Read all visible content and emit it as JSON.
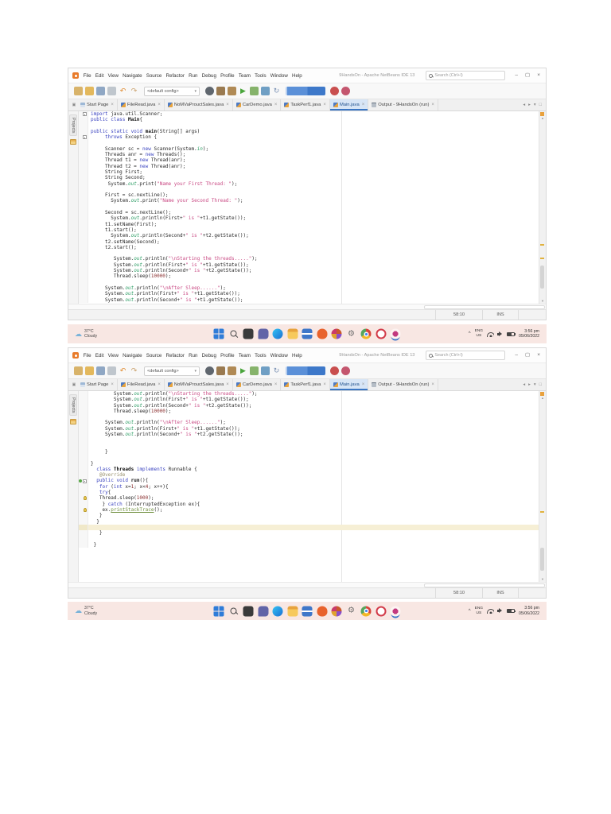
{
  "app": {
    "title": "9HandsOn - Apache NetBeans IDE 13",
    "menus": [
      "File",
      "Edit",
      "View",
      "Navigate",
      "Source",
      "Refactor",
      "Run",
      "Debug",
      "Profile",
      "Team",
      "Tools",
      "Window",
      "Help"
    ],
    "search_placeholder": "Search (Ctrl+I)",
    "window_controls": {
      "minimize": "–",
      "maximize": "▢",
      "close": "×"
    },
    "toolbar": {
      "config_label": "<default config>",
      "icons": [
        {
          "name": "new-file-icon",
          "color": "#d8b36a",
          "shape": "square"
        },
        {
          "name": "open-project-icon",
          "color": "#e3b85c",
          "shape": "square"
        },
        {
          "name": "save-all-icon",
          "color": "#8fa7c4",
          "shape": "square"
        },
        {
          "name": "copy-icon",
          "color": "#bfc6cd",
          "shape": "square"
        },
        {
          "name": "undo-icon",
          "color": "#e08a2e",
          "glyph": "↶"
        },
        {
          "name": "redo-icon",
          "color": "#c9a06a",
          "glyph": "↷"
        },
        {
          "type": "select"
        },
        {
          "name": "ide-globe-icon",
          "color": "#5f666e",
          "shape": "circle"
        },
        {
          "name": "build-project-icon",
          "color": "#9a7a50",
          "shape": "square"
        },
        {
          "name": "clean-build-icon",
          "color": "#b08a55",
          "shape": "square"
        },
        {
          "name": "run-project-icon",
          "color": "#4aa53c",
          "glyph": "▶"
        },
        {
          "name": "debug-project-icon",
          "color": "#86b36b",
          "shape": "square"
        },
        {
          "name": "profile-project-icon",
          "color": "#6f9fc4",
          "shape": "square"
        },
        {
          "name": "reload-icon",
          "color": "#7c93b5",
          "glyph": "↻"
        },
        {
          "type": "mem"
        },
        {
          "name": "profiler-stop-icon",
          "color": "#c94f4f",
          "shape": "circle"
        },
        {
          "name": "profiler-gc-icon",
          "color": "#c4566e",
          "shape": "circle"
        }
      ]
    },
    "tabs": [
      {
        "label": "Start Page",
        "type": "page"
      },
      {
        "label": "FileRead.java",
        "type": "java"
      },
      {
        "label": "NoMVaProuctSales.java",
        "type": "java"
      },
      {
        "label": "CarDemo.java",
        "type": "java"
      },
      {
        "label": "TaskPerf1.java",
        "type": "java"
      },
      {
        "label": "Main.java",
        "type": "java",
        "active": true
      },
      {
        "label": "Output - 9HandsOn (run)",
        "type": "output"
      }
    ],
    "tabnav": [
      {
        "name": "scroll-left-icon",
        "glyph": "◂"
      },
      {
        "name": "scroll-right-icon",
        "glyph": "▸"
      },
      {
        "name": "document-list-icon",
        "glyph": "▾"
      },
      {
        "name": "maximize-window-icon",
        "glyph": "□"
      }
    ],
    "corner_icon": "▣",
    "projects_label": "Projects",
    "status_caret": "58:10",
    "status_mode": "INS",
    "colors": {
      "accent": "#3a76c4",
      "active_tab_bg": "#d7e5f6",
      "string": "#c94a84",
      "keyword": "#3b44c0",
      "highlight_line": "#f6efd5",
      "error_stripe": "#e9a13c"
    }
  },
  "taskbar": {
    "temp": "37°C",
    "condition": "Cloudy",
    "lang_line1": "ENG",
    "lang_line2": "US",
    "time": "3:56 pm",
    "date": "05/06/2022",
    "icons": [
      {
        "name": "start-icon",
        "color": "#2f7cd8"
      },
      {
        "name": "search-icon",
        "color": "#4a4a4a"
      },
      {
        "name": "photos-icon",
        "color": "#3a3a3a"
      },
      {
        "name": "chat-icon",
        "color": "#6264a7"
      },
      {
        "name": "edge-icon",
        "color": "#1b6fd4"
      },
      {
        "name": "file-explorer-icon",
        "color": "#f0b42e"
      },
      {
        "name": "mail-icon",
        "color": "#3f77c9"
      },
      {
        "name": "brave-icon",
        "color": "#e8622c"
      },
      {
        "name": "media-icon",
        "color": "#c9582c"
      },
      {
        "name": "settings-icon",
        "color": "#6e6e6e",
        "glyph": "⚙"
      },
      {
        "name": "chrome-icon",
        "color": "#d7453c"
      },
      {
        "name": "opera-icon",
        "color": "#d23b49"
      },
      {
        "name": "picker-icon",
        "color": "#c2397f"
      }
    ]
  },
  "editors": {
    "one": {
      "lines": [
        {
          "g": "fold",
          "t": [
            [
              "k",
              "import "
            ],
            [
              "p",
              "java.util.Scanner;"
            ]
          ]
        },
        {
          "t": [
            [
              "k",
              "public class "
            ],
            [
              "b",
              "Main"
            ],
            [
              "p",
              "{"
            ]
          ]
        },
        {
          "t": []
        },
        {
          "t": [
            [
              "k",
              "public static void "
            ],
            [
              "b",
              "main"
            ],
            [
              "p",
              "(String[] args)"
            ]
          ]
        },
        {
          "g": "fold",
          "t": [
            [
              "p",
              "     "
            ],
            [
              "k",
              "throws "
            ],
            [
              "p",
              "Exception {"
            ]
          ]
        },
        {
          "t": []
        },
        {
          "t": [
            [
              "p",
              "     Scanner sc = "
            ],
            [
              "k",
              "new "
            ],
            [
              "p",
              "Scanner(System."
            ],
            [
              "f",
              "in"
            ],
            [
              "p",
              ");"
            ]
          ]
        },
        {
          "t": [
            [
              "p",
              "     Threads anr = "
            ],
            [
              "k",
              "new "
            ],
            [
              "p",
              "Threads();"
            ]
          ]
        },
        {
          "t": [
            [
              "p",
              "     Thread t1 = "
            ],
            [
              "k",
              "new "
            ],
            [
              "p",
              "Thread(anr);"
            ]
          ]
        },
        {
          "t": [
            [
              "p",
              "     Thread t2 = "
            ],
            [
              "k",
              "new "
            ],
            [
              "p",
              "Thread(anr);"
            ]
          ]
        },
        {
          "t": [
            [
              "p",
              "     String First;"
            ]
          ]
        },
        {
          "t": [
            [
              "p",
              "     String Second;"
            ]
          ]
        },
        {
          "t": [
            [
              "p",
              "      System."
            ],
            [
              "f",
              "out"
            ],
            [
              "p",
              ".print("
            ],
            [
              "s",
              "\"Name your First Thread: \""
            ],
            [
              "p",
              ");"
            ]
          ]
        },
        {
          "t": []
        },
        {
          "t": [
            [
              "p",
              "     First = sc.nextLine();"
            ]
          ]
        },
        {
          "t": [
            [
              "p",
              "       System."
            ],
            [
              "f",
              "out"
            ],
            [
              "p",
              ".print("
            ],
            [
              "s",
              "\"Name your Second Thread: \""
            ],
            [
              "p",
              ");"
            ]
          ]
        },
        {
          "t": []
        },
        {
          "t": [
            [
              "p",
              "     Second = sc.nextLine();"
            ]
          ]
        },
        {
          "t": [
            [
              "p",
              "       System."
            ],
            [
              "f",
              "out"
            ],
            [
              "p",
              ".println(First+"
            ],
            [
              "s",
              "\" is \""
            ],
            [
              "p",
              "+t1.getState());"
            ]
          ]
        },
        {
          "t": [
            [
              "p",
              "     t1.setName(First);"
            ]
          ]
        },
        {
          "t": [
            [
              "p",
              "     t1.start();"
            ]
          ]
        },
        {
          "t": [
            [
              "p",
              "       System."
            ],
            [
              "f",
              "out"
            ],
            [
              "p",
              ".println(Second+"
            ],
            [
              "s",
              "\" is \""
            ],
            [
              "p",
              "+t2.getState());"
            ]
          ]
        },
        {
          "t": [
            [
              "p",
              "     t2.setName(Second);"
            ]
          ]
        },
        {
          "t": [
            [
              "p",
              "     t2.start();"
            ]
          ]
        },
        {
          "t": []
        },
        {
          "t": [
            [
              "p",
              "        System."
            ],
            [
              "f",
              "out"
            ],
            [
              "p",
              ".println("
            ],
            [
              "s",
              "\"\\nStarting the threads.....\""
            ],
            [
              "p",
              ");"
            ]
          ]
        },
        {
          "t": [
            [
              "p",
              "        System."
            ],
            [
              "f",
              "out"
            ],
            [
              "p",
              ".println(First+"
            ],
            [
              "s",
              "\" is \""
            ],
            [
              "p",
              "+t1.getState());"
            ]
          ]
        },
        {
          "t": [
            [
              "p",
              "        System."
            ],
            [
              "f",
              "out"
            ],
            [
              "p",
              ".println(Second+"
            ],
            [
              "s",
              "\" is \""
            ],
            [
              "p",
              "+t2.getState());"
            ]
          ]
        },
        {
          "t": [
            [
              "p",
              "        Thread.sleep("
            ],
            [
              "n",
              "10000"
            ],
            [
              "p",
              ");"
            ]
          ]
        },
        {
          "t": []
        },
        {
          "t": [
            [
              "p",
              "     System."
            ],
            [
              "f",
              "out"
            ],
            [
              "p",
              ".println("
            ],
            [
              "s",
              "\"\\nAfter Sleep......\""
            ],
            [
              "p",
              ");"
            ]
          ]
        },
        {
          "t": [
            [
              "p",
              "     System."
            ],
            [
              "f",
              "out"
            ],
            [
              "p",
              ".println(First+"
            ],
            [
              "s",
              "\" is \""
            ],
            [
              "p",
              "+t1.getState());"
            ]
          ]
        },
        {
          "t": [
            [
              "p",
              "     System."
            ],
            [
              "f",
              "out"
            ],
            [
              "p",
              ".println(Second+"
            ],
            [
              "s",
              "\" is \""
            ],
            [
              "p",
              "+t1.getState());"
            ]
          ]
        }
      ]
    },
    "two": {
      "lines": [
        {
          "t": [
            [
              "p",
              "        System."
            ],
            [
              "f",
              "out"
            ],
            [
              "p",
              ".println("
            ],
            [
              "s",
              "\"\\nStarting the threads.....\""
            ],
            [
              "p",
              ");"
            ]
          ]
        },
        {
          "t": [
            [
              "p",
              "        System."
            ],
            [
              "f",
              "out"
            ],
            [
              "p",
              ".println(First+"
            ],
            [
              "s",
              "\" is \""
            ],
            [
              "p",
              "+t1.getState());"
            ]
          ]
        },
        {
          "t": [
            [
              "p",
              "        System."
            ],
            [
              "f",
              "out"
            ],
            [
              "p",
              ".println(Second+"
            ],
            [
              "s",
              "\" is \""
            ],
            [
              "p",
              "+t2.getState());"
            ]
          ]
        },
        {
          "t": [
            [
              "p",
              "        Thread.sleep("
            ],
            [
              "n",
              "10000"
            ],
            [
              "p",
              ");"
            ]
          ]
        },
        {
          "t": []
        },
        {
          "t": [
            [
              "p",
              "     System."
            ],
            [
              "f",
              "out"
            ],
            [
              "p",
              ".println("
            ],
            [
              "s",
              "\"\\nAfter Sleep......\""
            ],
            [
              "p",
              ");"
            ]
          ]
        },
        {
          "t": [
            [
              "p",
              "     System."
            ],
            [
              "f",
              "out"
            ],
            [
              "p",
              ".println(First+"
            ],
            [
              "s",
              "\" is \""
            ],
            [
              "p",
              "+t1.getState());"
            ]
          ]
        },
        {
          "t": [
            [
              "p",
              "     System."
            ],
            [
              "f",
              "out"
            ],
            [
              "p",
              ".println(Second+"
            ],
            [
              "s",
              "\" is \""
            ],
            [
              "p",
              "+t2.getState());"
            ]
          ]
        },
        {
          "t": []
        },
        {
          "t": []
        },
        {
          "t": [
            [
              "p",
              "     }"
            ]
          ]
        },
        {
          "t": []
        },
        {
          "t": [
            [
              "p",
              "}"
            ]
          ]
        },
        {
          "t": [
            [
              "p",
              "  "
            ],
            [
              "k",
              "class "
            ],
            [
              "b",
              "Threads "
            ],
            [
              "k",
              "implements "
            ],
            [
              "p",
              "Runnable {"
            ]
          ]
        },
        {
          "t": [
            [
              "p",
              "   "
            ],
            [
              "a",
              "@Override"
            ]
          ]
        },
        {
          "g": "greenfold",
          "t": [
            [
              "p",
              "  "
            ],
            [
              "k",
              "public void "
            ],
            [
              "b",
              "run"
            ],
            [
              "p",
              "(){"
            ]
          ]
        },
        {
          "t": [
            [
              "p",
              "   "
            ],
            [
              "k",
              "for "
            ],
            [
              "p",
              "("
            ],
            [
              "k",
              "int"
            ],
            [
              "p",
              " x="
            ],
            [
              "n",
              "1"
            ],
            [
              "p",
              "; x<"
            ],
            [
              "n",
              "4"
            ],
            [
              "p",
              "; x++){"
            ]
          ]
        },
        {
          "t": [
            [
              "p",
              "   "
            ],
            [
              "k",
              "try"
            ],
            [
              "p",
              "{"
            ]
          ]
        },
        {
          "g": "bulb",
          "t": [
            [
              "p",
              "   Thread.sleep("
            ],
            [
              "n",
              "1000"
            ],
            [
              "p",
              ");"
            ]
          ]
        },
        {
          "t": [
            [
              "p",
              "    } "
            ],
            [
              "k",
              "catch "
            ],
            [
              "p",
              "(InterruptedException ex){"
            ]
          ]
        },
        {
          "g": "bulb",
          "t": [
            [
              "p",
              "    ex."
            ],
            [
              "u",
              "printStackTrace"
            ],
            [
              "p",
              "();"
            ]
          ]
        },
        {
          "t": [
            [
              "p",
              "   }"
            ]
          ]
        },
        {
          "t": [
            [
              "p",
              "  }"
            ]
          ]
        },
        {
          "h": true,
          "t": []
        },
        {
          "t": [
            [
              "p",
              "   }"
            ]
          ]
        },
        {
          "t": []
        },
        {
          "t": [
            [
              "p",
              " }"
            ]
          ]
        }
      ]
    }
  }
}
